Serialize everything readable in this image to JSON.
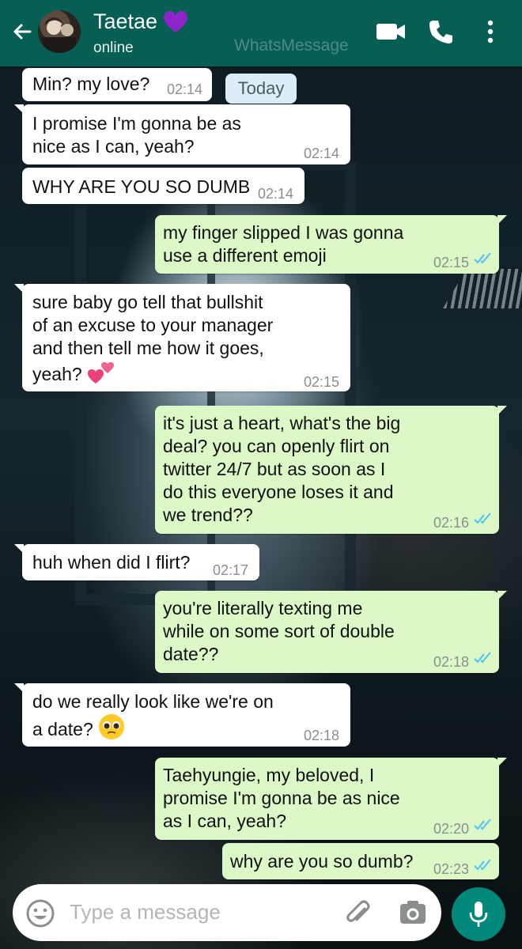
{
  "header": {
    "contact_name": "Taetae",
    "status": "online",
    "watermark": "WhatsMessage",
    "heart_color": "#8e24c9",
    "icons": [
      "back-arrow-icon",
      "video-call-icon",
      "voice-call-icon",
      "more-options-icon"
    ]
  },
  "date_chip": "Today",
  "messages": [
    {
      "dir": "in",
      "text": "Min? my love?",
      "time": "02:14"
    },
    {
      "dir": "in",
      "text": "I promise I'm gonna be as\nnice as I can, yeah?",
      "time": "02:14"
    },
    {
      "dir": "in",
      "text": "WHY ARE YOU SO DUMB",
      "time": "02:14"
    },
    {
      "dir": "out",
      "text": "my finger slipped I was gonna\nuse a different emoji",
      "time": "02:15",
      "status": "read"
    },
    {
      "dir": "in",
      "text": "sure baby go tell that bullshit\nof an excuse to your manager\nand then tell me how it goes,\nyeah?",
      "emoji": "two-hearts",
      "time": "02:15"
    },
    {
      "dir": "out",
      "text": "it's just a heart, what's the big\ndeal? you can openly flirt on\ntwitter 24/7 but as soon as I\ndo this everyone loses it and\nwe trend??",
      "time": "02:16",
      "status": "read"
    },
    {
      "dir": "in",
      "text": "huh when did I flirt?",
      "time": "02:17"
    },
    {
      "dir": "out",
      "text": "you're literally texting me\nwhile on some sort of double\ndate??",
      "time": "02:18",
      "status": "read"
    },
    {
      "dir": "in",
      "text": "do we really look like we're on\na date?",
      "emoji": "pleading-face",
      "time": "02:18"
    },
    {
      "dir": "out",
      "text": "Taehyungie, my beloved, I\npromise I'm gonna be as nice\nas I can, yeah?",
      "time": "02:20",
      "status": "read"
    },
    {
      "dir": "out",
      "text": "why are you so dumb?",
      "time": "02:23",
      "status": "read"
    }
  ],
  "input": {
    "placeholder": "Type a message",
    "icons": [
      "emoji-icon",
      "attach-icon",
      "camera-icon",
      "mic-icon"
    ]
  },
  "colors": {
    "header": "#075e54",
    "outgoing_bubble": "#dcf8c6",
    "incoming_bubble": "#ffffff",
    "read_ticks": "#4fc3f7",
    "mic_button": "#00897b"
  }
}
